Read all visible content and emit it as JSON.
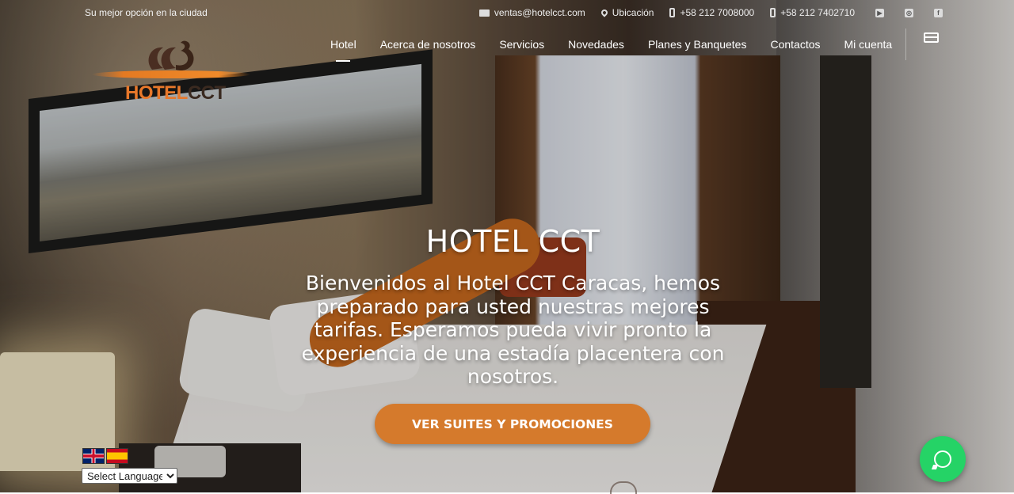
{
  "topbar": {
    "tagline": "Su mejor opción en la ciudad",
    "email": "ventas@hotelcct.com",
    "location": "Ubicación",
    "phone1": "+58 212 7008000",
    "phone2": "+58 212 7402710",
    "social": [
      "youtube-icon",
      "instagram-icon",
      "facebook-icon"
    ]
  },
  "logo": {
    "text_a": "HOTEL",
    "text_b": "CCT"
  },
  "nav": {
    "items": [
      "Hotel",
      "Acerca de nosotros",
      "Servicios",
      "Novedades",
      "Planes y Banquetes",
      "Contactos",
      "Mi cuenta"
    ],
    "active": "Hotel"
  },
  "hero": {
    "title": "HOTEL CCT",
    "subtitle": "Bienvenidos al Hotel CCT Caracas, hemos preparado para usted nuestras mejores tarifas. Esperamos pueda vivir pronto la experiencia de una estadía placentera con nosotros.",
    "cta": "VER SUITES Y PROMOCIONES"
  },
  "language": {
    "selected": "Select Language",
    "flags": [
      "flag-uk",
      "flag-es"
    ]
  },
  "colors": {
    "accent": "#d57a2c",
    "whatsapp": "#25d366",
    "logo_orange": "#e8782a"
  }
}
